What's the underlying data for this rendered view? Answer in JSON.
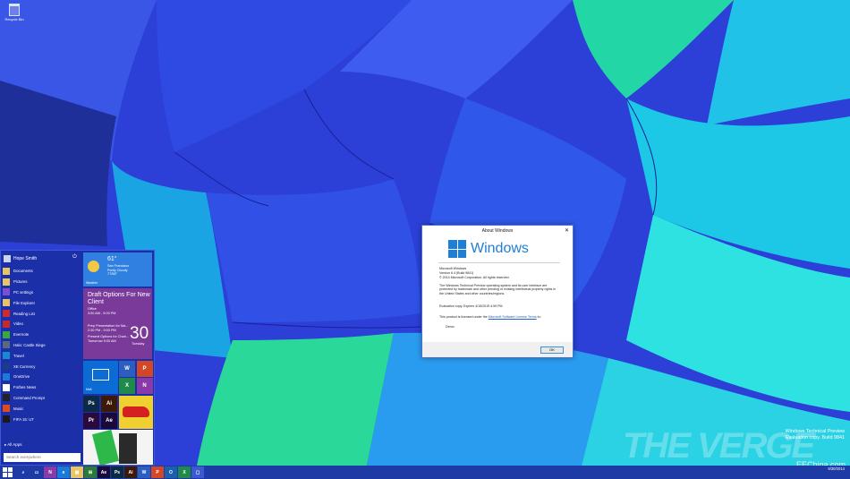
{
  "desktop": {
    "recycle_bin": "Recycle Bin",
    "watermark": "THE VERGE",
    "build_line1": "Windows Technical Preview",
    "build_line2": "Evaluation copy. Build 9841",
    "build_line3": "9/30/2014",
    "credit": "EEChina.com"
  },
  "start_menu": {
    "user": "Hope Smith",
    "apps": [
      {
        "label": "Documents",
        "icon": "folder-icon",
        "color": "#e8c560"
      },
      {
        "label": "Pictures",
        "icon": "pictures-icon",
        "color": "#e8c560"
      },
      {
        "label": "PC settings",
        "icon": "gear-icon",
        "color": "#7a4fd0"
      },
      {
        "label": "File Explorer",
        "icon": "folder-icon",
        "color": "#e8c560"
      },
      {
        "label": "Reading List",
        "icon": "reading-list-icon",
        "color": "#d02a2a"
      },
      {
        "label": "Video",
        "icon": "video-icon",
        "color": "#c82a2a"
      },
      {
        "label": "Evernote",
        "icon": "evernote-icon",
        "color": "#3ba83b"
      },
      {
        "label": "Halo: Castle Siege",
        "icon": "game-icon",
        "color": "#5a6a7a"
      },
      {
        "label": "Travel",
        "icon": "travel-icon",
        "color": "#1a8ad0"
      },
      {
        "label": "XE Currency",
        "icon": "currency-icon",
        "color": "#1b3c8a"
      },
      {
        "label": "OneDrive",
        "icon": "onedrive-icon",
        "color": "#1a7ad8"
      },
      {
        "label": "Forbes News",
        "icon": "news-icon",
        "color": "#ffffff"
      },
      {
        "label": "Command Prompt",
        "icon": "cmd-icon",
        "color": "#222222"
      },
      {
        "label": "Music",
        "icon": "music-icon",
        "color": "#e04a1a"
      },
      {
        "label": "FIFA 15: UT",
        "icon": "fifa-icon",
        "color": "#1a1a1a"
      }
    ],
    "all_apps": "All Apps",
    "search_placeholder": "Search everywhere",
    "weather": {
      "temp": "61°",
      "city": "San Francisco",
      "condition": "Partly Cloudy",
      "range": "77/58°",
      "name": "Weather"
    },
    "calendar": {
      "title": "Draft Options For New Client",
      "location": "Office",
      "time": "3:00 AM - 9:00 PM",
      "event2": "Prep Presentation for Ma...",
      "event2_time": "2:30 PM - 9:00 PM",
      "event3": "Present Options for Chari...",
      "event3_time": "Tomorrow 9:00 AM",
      "day": "30",
      "weekday": "Tuesday"
    },
    "mail_label": "Mail",
    "tiles_small": [
      {
        "text": "W",
        "icon": "word-icon",
        "color": "#2b5ebf"
      },
      {
        "text": "P",
        "icon": "powerpoint-icon",
        "color": "#d24726"
      },
      {
        "text": "X",
        "icon": "excel-icon",
        "color": "#1f8a4a"
      },
      {
        "text": "N",
        "icon": "onenote-icon",
        "color": "#8a3aa8"
      },
      {
        "text": "Ps",
        "icon": "photoshop-icon",
        "color": "#0a2a45"
      },
      {
        "text": "Ai",
        "icon": "illustrator-icon",
        "color": "#3d1a08"
      },
      {
        "text": "Pr",
        "icon": "premiere-icon",
        "color": "#2a0a3a"
      },
      {
        "text": "Ae",
        "icon": "aftereffects-icon",
        "color": "#1a0a3a"
      }
    ]
  },
  "dialog": {
    "title": "About Windows",
    "close": "✕",
    "logo_text": "Windows",
    "product": "Microsoft Windows",
    "version": "Version 6.4 (Build 9841)",
    "copyright": "© 2014 Microsoft Corporation. All rights reserved.",
    "legal": "The Windows Technical Preview operating system and its user interface are protected by trademark and other pending or existing intellectual property rights in the United States and other countries/regions.",
    "eval": "Evaluation copy. Expires 4/15/2015 4:59 PM",
    "license_pre": "This product is licensed under the ",
    "license_link": "Microsoft Software License Terms",
    "license_post": " to:",
    "licensee": "Demo",
    "ok": "OK"
  },
  "taskbar": {
    "buttons": [
      {
        "icon": "search-icon",
        "text": "⌕",
        "color": "#1d3aa5"
      },
      {
        "icon": "task-view-icon",
        "text": "▭",
        "color": "#1d3aa5"
      },
      {
        "icon": "onenote-icon",
        "text": "N",
        "color": "#8a3aa8"
      },
      {
        "icon": "ie-icon",
        "text": "e",
        "color": "#1a7ad8"
      },
      {
        "icon": "file-explorer-icon",
        "text": "▤",
        "color": "#e8c560"
      },
      {
        "icon": "store-icon",
        "text": "⊞",
        "color": "#2a7a3a"
      },
      {
        "icon": "aftereffects-icon",
        "text": "Ae",
        "color": "#1a0a3a"
      },
      {
        "icon": "photoshop-icon",
        "text": "Ps",
        "color": "#0a2a45"
      },
      {
        "icon": "illustrator-icon",
        "text": "Ai",
        "color": "#3d1a08"
      },
      {
        "icon": "word-icon",
        "text": "W",
        "color": "#2b5ebf"
      },
      {
        "icon": "powerpoint-icon",
        "text": "P",
        "color": "#d24726"
      },
      {
        "icon": "outlook-icon",
        "text": "O",
        "color": "#1a5fb0"
      },
      {
        "icon": "excel-icon",
        "text": "X",
        "color": "#1f8a4a"
      },
      {
        "icon": "window-icon",
        "text": "▢",
        "color": "#3a5ad0"
      }
    ]
  },
  "colors": {
    "accent": "#1e7fd4",
    "start_bg": "#1b2fa8",
    "taskbar_bg": "#1d3aa5"
  }
}
